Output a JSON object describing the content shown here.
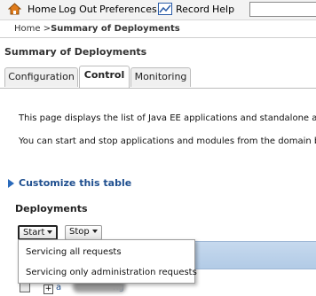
{
  "toolbar": {
    "home": "Home",
    "logout": "Log Out",
    "preferences": "Preferences",
    "record": "Record",
    "help": "Help",
    "search_value": ""
  },
  "breadcrumb": {
    "root": "Home >",
    "current": "Summary of Deployments"
  },
  "page_title": "Summary of Deployments",
  "tabs": [
    {
      "label": "Configuration",
      "active": false
    },
    {
      "label": "Control",
      "active": true
    },
    {
      "label": "Monitoring",
      "active": false
    }
  ],
  "description": [
    "This page displays the list of Java EE applications and standalone app",
    "You can start and stop applications and modules from the domain by"
  ],
  "customize_link": "Customize this table",
  "section_title": "Deployments",
  "buttons": {
    "start": "Start",
    "stop": "Stop"
  },
  "start_menu": [
    "Servicing all requests",
    "Servicing only administration requests"
  ],
  "row": {
    "name_fragment_left": "a",
    "name_fragment_right": "ng"
  },
  "icons": {
    "home": "home-icon",
    "record": "record-icon",
    "customize": "expand-triangle-icon",
    "row_expand": "plus-icon"
  }
}
